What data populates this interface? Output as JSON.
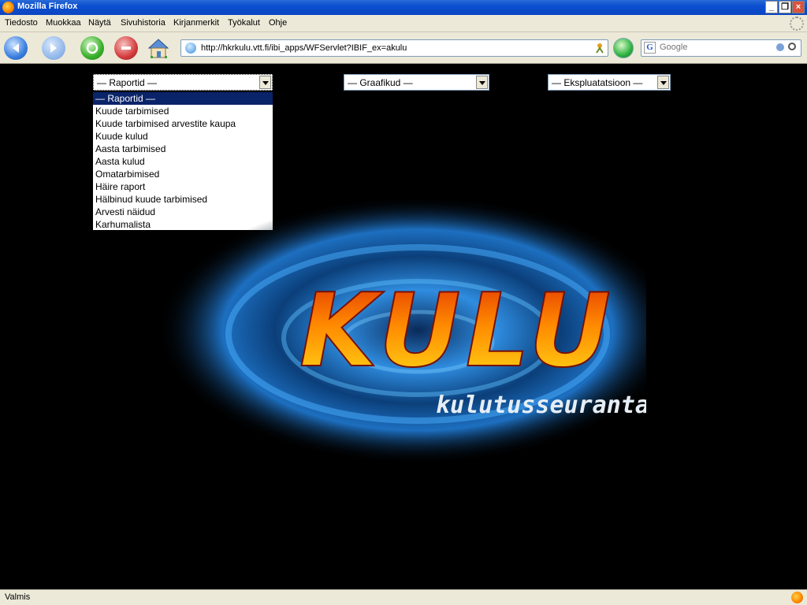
{
  "window": {
    "title": "Mozilla Firefox"
  },
  "menu": [
    "Tiedosto",
    "Muokkaa",
    "Näytä",
    "Sivuhistoria",
    "Kirjanmerkit",
    "Työkalut",
    "Ohje"
  ],
  "address": {
    "url": "http://hkrkulu.vtt.fi/ibi_apps/WFServlet?IBIF_ex=akulu"
  },
  "search": {
    "placeholder": "Google"
  },
  "selects": {
    "reports": "— Raportid —",
    "graphs": "— Graafikud —",
    "operations": "— Ekspluatatsioon —"
  },
  "report_options": [
    "— Raportid —",
    "Kuude tarbimised",
    "Kuude tarbimised arvestite kaupa",
    "Kuude kulud",
    "Aasta tarbimised",
    "Aasta kulud",
    "Omatarbimised",
    "Häire raport",
    "Hälbinud kuude tarbimised",
    "Arvesti näidud",
    "Karhumalista"
  ],
  "logo": {
    "title": "KULU",
    "subtitle": "kulutusseuranta"
  },
  "status": {
    "text": "Valmis"
  },
  "colors": {
    "titlebar": "#0b45c2",
    "chrome": "#ece9d8",
    "selected_option": "#0a246a",
    "page_bg": "#000000"
  }
}
